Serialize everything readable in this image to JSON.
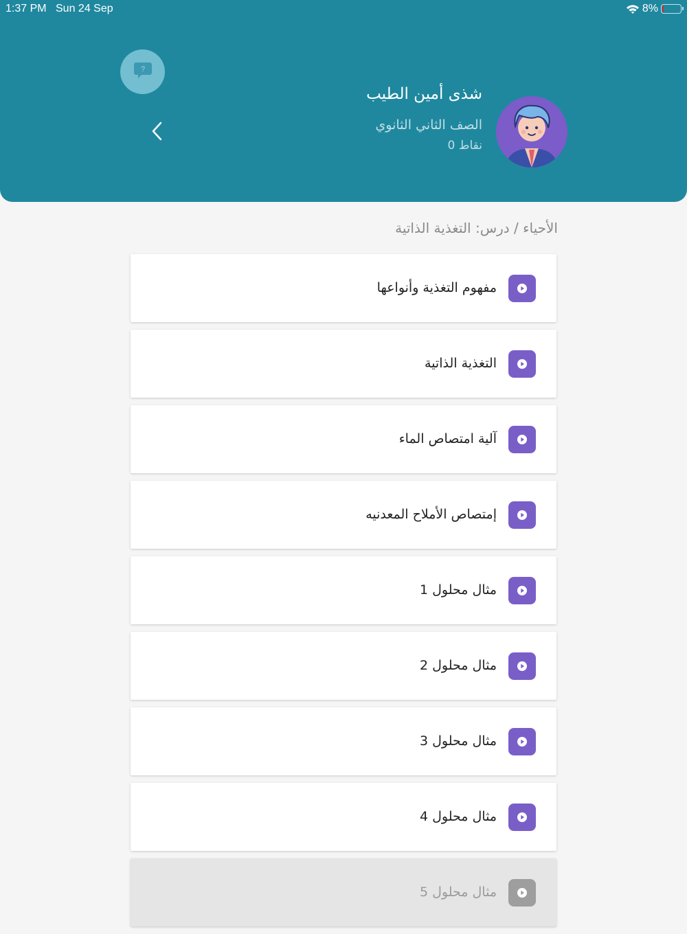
{
  "status_bar": {
    "time": "1:37 PM",
    "date": "Sun 24 Sep",
    "battery": "8%",
    "battery_level": 0.08,
    "battery_color": "#e0282e"
  },
  "header": {
    "background_color": "#1f889f",
    "user_name": "شذى أمين الطيب",
    "grade": "الصف الثاني الثانوي",
    "points": "نقاط 0",
    "help_icon": "question-bubble-icon",
    "back_icon": "chevron-left-icon"
  },
  "breadcrumb": "الأحياء / درس: التغذية الذاتية",
  "lessons": [
    {
      "title": "مفهوم التغذية وأنواعها",
      "locked": false
    },
    {
      "title": "التغذية الذاتية",
      "locked": false
    },
    {
      "title": "آلية امتصاص الماء",
      "locked": false
    },
    {
      "title": "إمتصاص الأملاح المعدنيه",
      "locked": false
    },
    {
      "title": "مثال محلول 1",
      "locked": false
    },
    {
      "title": "مثال محلول 2",
      "locked": false
    },
    {
      "title": "مثال محلول 3",
      "locked": false
    },
    {
      "title": "مثال محلول 4",
      "locked": false
    },
    {
      "title": "مثال محلول 5",
      "locked": true
    }
  ],
  "colors": {
    "accent": "#7a5ec8",
    "locked": "#9e9e9e"
  }
}
